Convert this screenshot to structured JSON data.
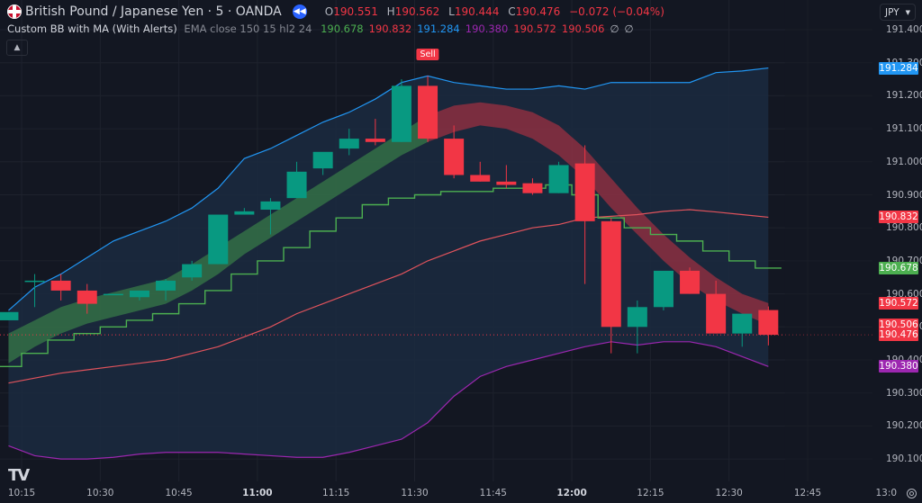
{
  "header": {
    "symbol_title": "British Pound / Japanese Yen · 5 · OANDA",
    "flag_icon": "uk-flag-icon",
    "replay_icon": "rewind-icon",
    "ohlc": {
      "o_label": "O",
      "o": "190.551",
      "h_label": "H",
      "h": "190.562",
      "l_label": "L",
      "l": "190.444",
      "c_label": "C",
      "c": "190.476",
      "change": "−0.072 (−0.04%)"
    }
  },
  "indicator": {
    "name": "Custom BB with MA (With Alerts)",
    "params": "EMA close 150 15 hl2 24",
    "values": [
      {
        "text": "190.678",
        "color": "#4caf50"
      },
      {
        "text": "190.832",
        "color": "#f23645"
      },
      {
        "text": "191.284",
        "color": "#2196f3"
      },
      {
        "text": "190.380",
        "color": "#9c27b0"
      },
      {
        "text": "190.572",
        "color": "#f23645"
      },
      {
        "text": "190.506",
        "color": "#f23645"
      }
    ],
    "na_symbols": [
      "∅",
      "∅"
    ],
    "collapse_icon": "chevron-up-icon"
  },
  "axis": {
    "currency": "JPY",
    "y_ticks": [
      "191.400",
      "191.300",
      "191.200",
      "191.100",
      "191.000",
      "190.900",
      "190.800",
      "190.700",
      "190.600",
      "190.500",
      "190.400",
      "190.300",
      "190.200",
      "190.100"
    ],
    "x_ticks": [
      {
        "label": "10:15",
        "bold": false
      },
      {
        "label": "10:30",
        "bold": false
      },
      {
        "label": "10:45",
        "bold": false
      },
      {
        "label": "11:00",
        "bold": true
      },
      {
        "label": "11:15",
        "bold": false
      },
      {
        "label": "11:30",
        "bold": false
      },
      {
        "label": "11:45",
        "bold": false
      },
      {
        "label": "12:00",
        "bold": true
      },
      {
        "label": "12:15",
        "bold": false
      },
      {
        "label": "12:30",
        "bold": false
      },
      {
        "label": "12:45",
        "bold": false
      },
      {
        "label": "13:0",
        "bold": false
      }
    ],
    "price_labels": [
      {
        "text": "191.284",
        "color": "#2196f3",
        "price": 191.284
      },
      {
        "text": "190.832",
        "color": "#f23645",
        "price": 190.832
      },
      {
        "text": "190.678",
        "color": "#4caf50",
        "price": 190.678
      },
      {
        "text": "190.572",
        "color": "#f23645",
        "price": 190.572
      },
      {
        "text": "190.506",
        "color": "#f23645",
        "price": 190.506
      },
      {
        "text": "190.476",
        "color": "#f23645",
        "price": 190.476
      },
      {
        "text": "190.380",
        "color": "#9c27b0",
        "price": 190.38
      }
    ],
    "settings_icon": "gear-icon"
  },
  "logo": "TV",
  "chart_data": {
    "type": "candlestick",
    "title": "British Pound / Japanese Yen · 5 · OANDA",
    "xlabel": "",
    "ylabel": "JPY",
    "ylim": [
      190.05,
      191.45
    ],
    "grid": true,
    "interval_minutes": 5,
    "first_bar_time": "10:10",
    "last_price": 190.476,
    "candles": [
      {
        "t": "10:10",
        "o": 190.52,
        "h": 190.545,
        "l": 190.52,
        "c": 190.545
      },
      {
        "t": "10:15",
        "o": 190.64,
        "h": 190.66,
        "l": 190.56,
        "c": 190.64
      },
      {
        "t": "10:20",
        "o": 190.64,
        "h": 190.66,
        "l": 190.58,
        "c": 190.61
      },
      {
        "t": "10:25",
        "o": 190.61,
        "h": 190.63,
        "l": 190.54,
        "c": 190.57
      },
      {
        "t": "10:30",
        "o": 190.6,
        "h": 190.6,
        "l": 190.6,
        "c": 190.6
      },
      {
        "t": "10:35",
        "o": 190.59,
        "h": 190.61,
        "l": 190.58,
        "c": 190.61
      },
      {
        "t": "10:40",
        "o": 190.61,
        "h": 190.645,
        "l": 190.58,
        "c": 190.64
      },
      {
        "t": "10:45",
        "o": 190.65,
        "h": 190.7,
        "l": 190.64,
        "c": 190.69
      },
      {
        "t": "10:50",
        "o": 190.69,
        "h": 190.83,
        "l": 190.69,
        "c": 190.84
      },
      {
        "t": "10:55",
        "o": 190.84,
        "h": 190.86,
        "l": 190.84,
        "c": 190.85
      },
      {
        "t": "11:00",
        "o": 190.855,
        "h": 190.89,
        "l": 190.78,
        "c": 190.88
      },
      {
        "t": "11:05",
        "o": 190.89,
        "h": 191.0,
        "l": 190.89,
        "c": 190.97
      },
      {
        "t": "11:10",
        "o": 190.98,
        "h": 191.02,
        "l": 190.96,
        "c": 191.03
      },
      {
        "t": "11:15",
        "o": 191.04,
        "h": 191.1,
        "l": 191.02,
        "c": 191.07
      },
      {
        "t": "11:20",
        "o": 191.07,
        "h": 191.13,
        "l": 191.05,
        "c": 191.06
      },
      {
        "t": "11:25",
        "o": 191.06,
        "h": 191.25,
        "l": 191.06,
        "c": 191.23
      },
      {
        "t": "11:30",
        "o": 191.23,
        "h": 191.26,
        "l": 191.06,
        "c": 191.07
      },
      {
        "t": "11:35",
        "o": 191.07,
        "h": 191.11,
        "l": 190.95,
        "c": 190.96
      },
      {
        "t": "11:40",
        "o": 190.96,
        "h": 191.0,
        "l": 190.94,
        "c": 190.94
      },
      {
        "t": "11:45",
        "o": 190.94,
        "h": 190.99,
        "l": 190.92,
        "c": 190.93
      },
      {
        "t": "11:50",
        "o": 190.935,
        "h": 190.95,
        "l": 190.9,
        "c": 190.905
      },
      {
        "t": "11:55",
        "o": 190.905,
        "h": 191.0,
        "l": 190.905,
        "c": 190.99
      },
      {
        "t": "12:00",
        "o": 190.995,
        "h": 191.05,
        "l": 190.63,
        "c": 190.82
      },
      {
        "t": "12:05",
        "o": 190.82,
        "h": 190.83,
        "l": 190.42,
        "c": 190.5
      },
      {
        "t": "12:10",
        "o": 190.5,
        "h": 190.58,
        "l": 190.42,
        "c": 190.56
      },
      {
        "t": "12:15",
        "o": 190.56,
        "h": 190.66,
        "l": 190.55,
        "c": 190.67
      },
      {
        "t": "12:20",
        "o": 190.67,
        "h": 190.68,
        "l": 190.6,
        "c": 190.6
      },
      {
        "t": "12:25",
        "o": 190.6,
        "h": 190.64,
        "l": 190.48,
        "c": 190.48
      },
      {
        "t": "12:30",
        "o": 190.48,
        "h": 190.51,
        "l": 190.44,
        "c": 190.54
      },
      {
        "t": "12:35",
        "o": 190.551,
        "h": 190.562,
        "l": 190.444,
        "c": 190.476
      }
    ],
    "series": [
      {
        "name": "BB upper",
        "color": "#2196f3",
        "values": [
          190.55,
          190.62,
          190.66,
          190.71,
          190.76,
          190.79,
          190.82,
          190.86,
          190.92,
          191.01,
          191.04,
          191.08,
          191.12,
          191.15,
          191.19,
          191.24,
          191.26,
          191.24,
          191.23,
          191.22,
          191.22,
          191.23,
          191.22,
          191.24,
          191.24,
          191.24,
          191.24,
          191.27,
          191.275,
          191.284
        ]
      },
      {
        "name": "BB basis",
        "color": "#e0535c",
        "values": [
          190.33,
          190.345,
          190.36,
          190.37,
          190.38,
          190.39,
          190.4,
          190.42,
          190.44,
          190.47,
          190.5,
          190.54,
          190.57,
          190.6,
          190.63,
          190.66,
          190.7,
          190.73,
          190.76,
          190.78,
          190.8,
          190.81,
          190.83,
          190.835,
          190.84,
          190.85,
          190.855,
          190.848,
          190.84,
          190.832
        ]
      },
      {
        "name": "BB lower",
        "color": "#9c27b0",
        "values": [
          190.14,
          190.11,
          190.1,
          190.1,
          190.105,
          190.115,
          190.12,
          190.12,
          190.12,
          190.115,
          190.11,
          190.105,
          190.105,
          190.12,
          190.14,
          190.16,
          190.21,
          190.29,
          190.35,
          190.38,
          190.4,
          190.42,
          190.44,
          190.455,
          190.445,
          190.455,
          190.455,
          190.44,
          190.41,
          190.38
        ]
      },
      {
        "name": "Step MA",
        "color": "#4caf50",
        "values": [
          190.38,
          190.42,
          190.46,
          190.48,
          190.5,
          190.52,
          190.54,
          190.57,
          190.61,
          190.66,
          190.7,
          190.74,
          190.79,
          190.83,
          190.87,
          190.89,
          190.9,
          190.91,
          190.91,
          190.92,
          190.92,
          190.93,
          190.9,
          190.83,
          190.8,
          190.78,
          190.76,
          190.73,
          190.7,
          190.678
        ]
      },
      {
        "name": "Ribbon fast",
        "color": "#4caf50",
        "values": [
          190.48,
          190.52,
          190.56,
          190.585,
          190.605,
          190.625,
          190.645,
          190.69,
          190.74,
          190.79,
          190.84,
          190.89,
          190.94,
          190.99,
          191.04,
          191.09,
          191.14,
          191.17,
          191.18,
          191.17,
          191.15,
          191.11,
          191.04,
          190.95,
          190.86,
          190.78,
          190.71,
          190.65,
          190.6,
          190.572
        ]
      },
      {
        "name": "Ribbon slow",
        "color": "#f23645",
        "values": [
          190.39,
          190.44,
          190.48,
          190.51,
          190.53,
          190.55,
          190.57,
          190.61,
          190.66,
          190.72,
          190.77,
          190.82,
          190.87,
          190.92,
          190.97,
          191.02,
          191.06,
          191.09,
          191.11,
          191.1,
          191.07,
          191.02,
          190.95,
          190.86,
          190.78,
          190.7,
          190.63,
          190.58,
          190.54,
          190.506
        ]
      }
    ],
    "annotations": [
      {
        "text": "Sell",
        "bar": "11:30",
        "color": "#f23645"
      }
    ],
    "up_color": "#089981",
    "down_color": "#f23645"
  }
}
